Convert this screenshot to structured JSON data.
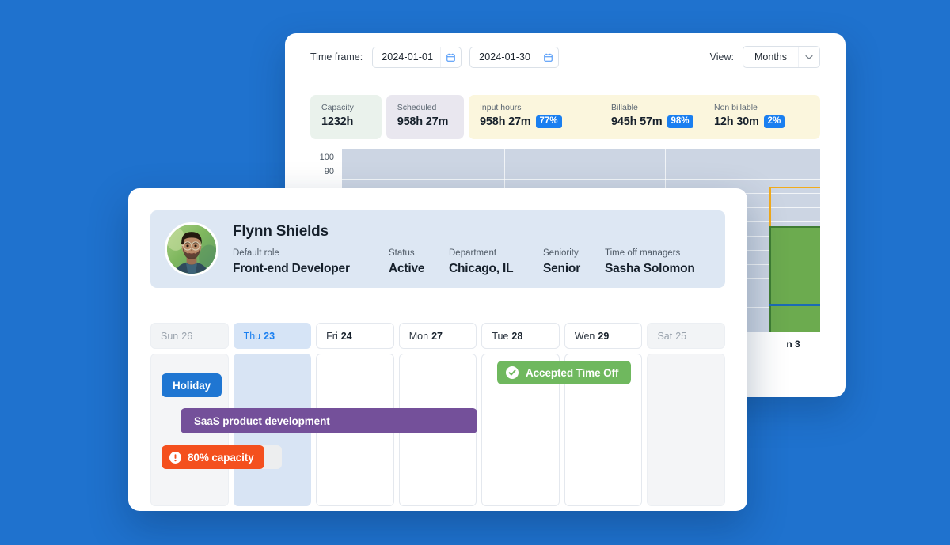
{
  "colors": {
    "page_background": "#1f72ce",
    "accent_blue": "#1a7ff0",
    "badge_blue": "#1a7ff0",
    "chip_holiday_blue": "#1f76d2",
    "chip_project_purple": "#74509a",
    "chip_capacity_orange": "#f4501e",
    "chip_timeoff_green": "#6fb85e",
    "bar_green": "#6cab4f",
    "bar_green_border": "#3f7d33",
    "bar_outline_amber": "#f1ab1c",
    "bar_line_blue": "#1c6bb5",
    "card_capacity_bg": "#eaf2ec",
    "card_scheduled_bg": "#e9e7ef",
    "card_yellow_bg": "#fbf6dd",
    "profile_banner_bg": "#dde7f3"
  },
  "toolbar": {
    "time_frame_label": "Time frame:",
    "date_from": "2024-01-01",
    "date_to": "2024-01-30",
    "date_from_placeholder": "YYYY-MM-DD",
    "date_to_placeholder": "YYYY-MM-DD",
    "calendar_icon": "calendar-icon",
    "view_label": "View:",
    "view_value": "Months",
    "view_options": [
      "Months"
    ],
    "chevron_icon": "chevron-down-icon"
  },
  "stats": {
    "capacity": {
      "label": "Capacity",
      "value": "1232h"
    },
    "scheduled": {
      "label": "Scheduled",
      "value": "958h 27m"
    },
    "input_hours": {
      "label": "Input hours",
      "value": "958h 27m",
      "percent": "77%"
    },
    "billable": {
      "label": "Billable",
      "value": "945h 57m",
      "percent": "98%"
    },
    "non_billable": {
      "label": "Non billable",
      "value": "12h 30m",
      "percent": "2%"
    }
  },
  "chart_data": {
    "type": "bar",
    "title": "",
    "xlabel": "",
    "ylabel": "",
    "categories": [
      "Jan 3"
    ],
    "series": [
      {
        "name": "Scheduled",
        "values": [
          78
        ]
      },
      {
        "name": "Capacity",
        "values": [
          97
        ]
      }
    ],
    "y_ticks": [
      100,
      90
    ],
    "ylim": [
      0,
      100
    ],
    "grid": true,
    "legend_position": "none",
    "annotations": [
      {
        "name": "capacity-outline",
        "value": 97,
        "style": "amber-outline"
      },
      {
        "name": "threshold-line",
        "value": 12,
        "style": "blue-line"
      }
    ],
    "tick_labels": [
      "100",
      "90"
    ],
    "x_tick_label_visible": "n 3"
  },
  "profile": {
    "avatar_alt": "user-avatar",
    "name": "Flynn Shields",
    "fields": [
      {
        "key": "Default role",
        "value": "Front-end Developer"
      },
      {
        "key": "Status",
        "value": "Active"
      },
      {
        "key": "Department",
        "value": "Chicago, IL"
      },
      {
        "key": "Seniority",
        "value": "Senior"
      },
      {
        "key": "Time off managers",
        "value": "Sasha Solomon"
      }
    ]
  },
  "calendar": {
    "days": [
      {
        "weekday": "Sun",
        "date": "26",
        "state": "weekend"
      },
      {
        "weekday": "Thu",
        "date": "23",
        "state": "selected"
      },
      {
        "weekday": "Fri",
        "date": "24",
        "state": "normal"
      },
      {
        "weekday": "Mon",
        "date": "27",
        "state": "normal"
      },
      {
        "weekday": "Tue",
        "date": "28",
        "state": "normal"
      },
      {
        "weekday": "Wen",
        "date": "29",
        "state": "normal"
      },
      {
        "weekday": "Sat",
        "date": "25",
        "state": "weekend"
      }
    ],
    "events": [
      {
        "name": "holiday-chip",
        "label": "Holiday",
        "icon": "none"
      },
      {
        "name": "project-chip",
        "label": "SaaS product development",
        "icon": "none"
      },
      {
        "name": "capacity-chip",
        "label": "80% capacity",
        "icon": "alert-circle-icon"
      },
      {
        "name": "time-off-chip",
        "label": "Accepted Time Off",
        "icon": "check-circle-icon"
      }
    ]
  }
}
